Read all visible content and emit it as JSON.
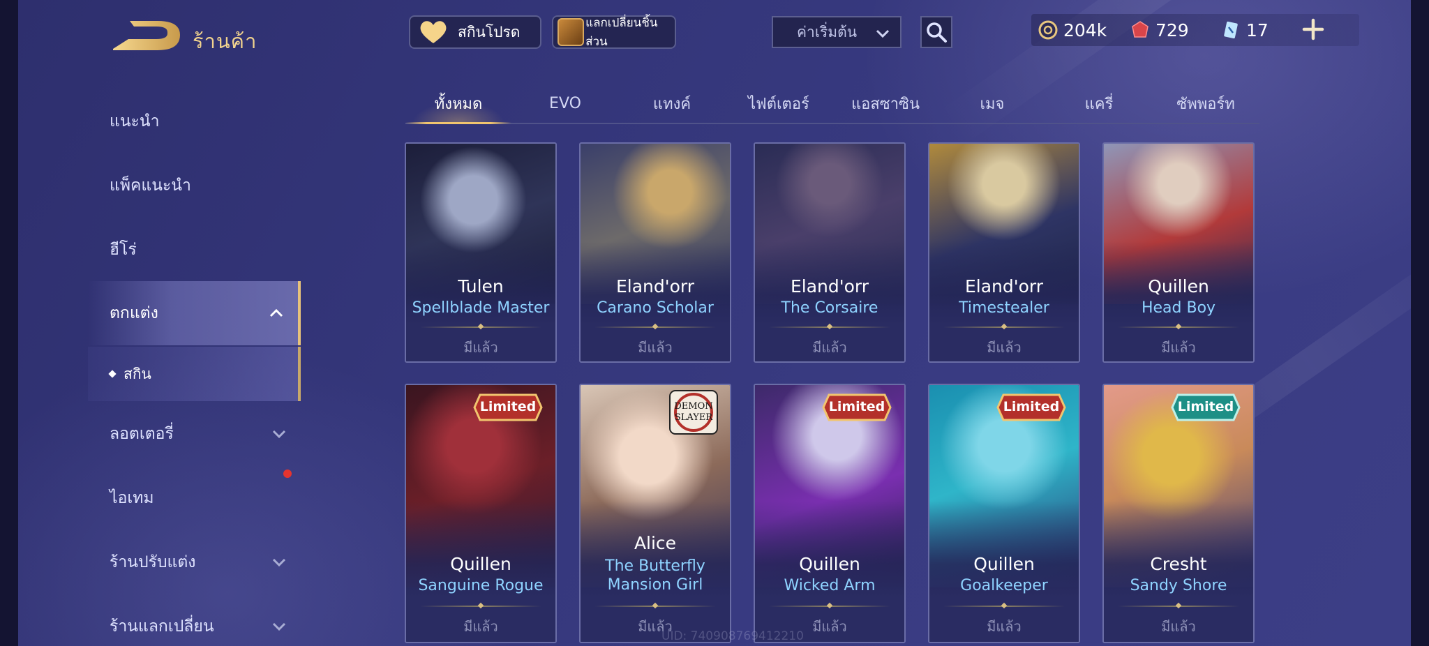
{
  "header": {
    "title": "ร้านค้า",
    "back_icon": "back-arrow-icon"
  },
  "sidebar": {
    "items": [
      {
        "label": "แนะนำ"
      },
      {
        "label": "แพ็คแนะนำ"
      },
      {
        "label": "ฮีโร่"
      },
      {
        "label": "ตกแต่ง"
      },
      {
        "label": "สกิน"
      },
      {
        "label": "ลอตเตอรี่"
      },
      {
        "label": "ไอเทม"
      },
      {
        "label": "ร้านปรับแต่ง"
      },
      {
        "label": "ร้านแลกเปลี่ยน"
      }
    ]
  },
  "topbar": {
    "favorites_label": "สกินโปรด",
    "fragment_exchange_label": "แลกเปลี่ยนชิ้นส่วน",
    "sort_value": "ค่าเริ่มต้น",
    "currencies": [
      {
        "icon": "gold-coin-icon",
        "value": "204k"
      },
      {
        "icon": "red-voucher-icon",
        "value": "729"
      },
      {
        "icon": "blue-coupon-icon",
        "value": "17"
      }
    ]
  },
  "tabs": [
    "ทั้งหมด",
    "EVO",
    "แทงค์",
    "ไฟต์เตอร์",
    "แอสซาซิน",
    "เมจ",
    "แครี่",
    "ซัพพอร์ท"
  ],
  "active_tab": "ทั้งหมด",
  "cards": [
    {
      "hero": "Tulen",
      "skin": "Spellblade Master",
      "status": "มีแล้ว"
    },
    {
      "hero": "Eland'orr",
      "skin": "Carano Scholar",
      "status": "มีแล้ว"
    },
    {
      "hero": "Eland'orr",
      "skin": "The Corsaire",
      "status": "มีแล้ว"
    },
    {
      "hero": "Eland'orr",
      "skin": "Timestealer",
      "status": "มีแล้ว"
    },
    {
      "hero": "Quillen",
      "skin": "Head Boy",
      "status": "มีแล้ว"
    },
    {
      "hero": "Quillen",
      "skin": "Sanguine Rogue",
      "status": "มีแล้ว",
      "badge": "Limited"
    },
    {
      "hero": "Alice",
      "skin_line1": "The Butterfly",
      "skin_line2": "Mansion Girl",
      "status": "มีแล้ว",
      "badge_text": "DEMON SLAYER"
    },
    {
      "hero": "Quillen",
      "skin": "Wicked Arm",
      "status": "มีแล้ว",
      "badge": "Limited"
    },
    {
      "hero": "Quillen",
      "skin": "Goalkeeper",
      "status": "มีแล้ว",
      "badge": "Limited"
    },
    {
      "hero": "Cresht",
      "skin": "Sandy Shore",
      "status": "มีแล้ว",
      "badge": "Limited"
    }
  ],
  "footer": {
    "uid": "UID: 740908769412210"
  },
  "colors": {
    "accent_gold": "#f1c56f",
    "skin_name_blue": "#8fd3ff",
    "limited_red": "#b3302a",
    "limited_teal": "#1d8f86"
  }
}
